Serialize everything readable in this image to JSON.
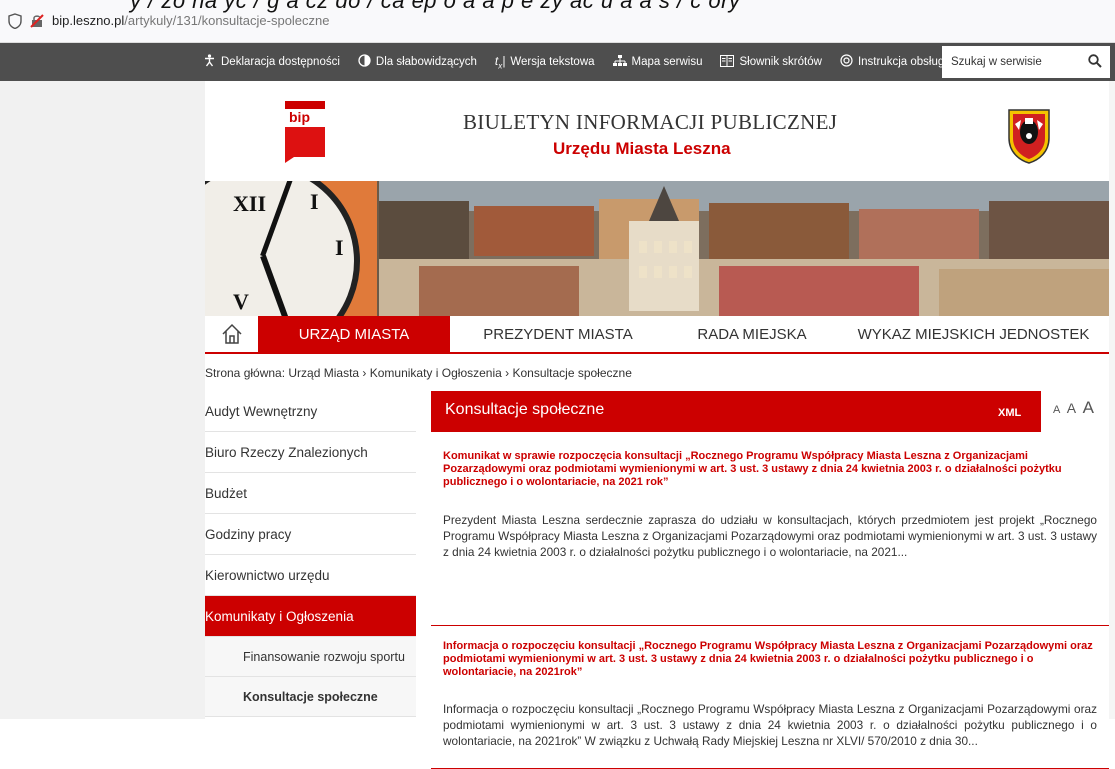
{
  "browser": {
    "url_host": "bip.leszno.pl",
    "url_path": "/artykuly/131/konsultacje-spoleczne",
    "cut_overlay_text": "y / zo na yc / g a cz do / ca ep o a a p e zy ac u a a s / c ory"
  },
  "topbar": {
    "items": [
      {
        "label": "Deklaracja dostępności",
        "icon": "accessibility-icon"
      },
      {
        "label": "Dla słabowidzących",
        "icon": "contrast-icon"
      },
      {
        "label": "Wersja tekstowa",
        "icon": "text-version-icon"
      },
      {
        "label": "Mapa serwisu",
        "icon": "sitemap-icon"
      },
      {
        "label": "Słownik skrótów",
        "icon": "dictionary-icon"
      },
      {
        "label": "Instrukcja obsługi",
        "icon": "help-icon"
      }
    ],
    "search_placeholder": "Szukaj w serwisie"
  },
  "header": {
    "logo_text": "bip",
    "title": "BIULETYN INFORMACJI PUBLICZNEJ",
    "subtitle": "Urzędu Miasta Leszna"
  },
  "nav": {
    "tabs": [
      {
        "label": "URZĄD MIASTA",
        "active": true
      },
      {
        "label": "PREZYDENT MIASTA",
        "active": false
      },
      {
        "label": "RADA MIEJSKA",
        "active": false
      },
      {
        "label": "WYKAZ MIEJSKICH JEDNOSTEK",
        "active": false
      }
    ]
  },
  "breadcrumb": "Strona główna: Urząd Miasta › Komunikaty i Ogłoszenia › Konsultacje społeczne",
  "sidebar": {
    "items": [
      {
        "label": "Audyt Wewnętrzny"
      },
      {
        "label": "Biuro Rzeczy Znalezionych"
      },
      {
        "label": "Budżet"
      },
      {
        "label": "Godziny pracy"
      },
      {
        "label": "Kierownictwo urzędu"
      },
      {
        "label": "Komunikaty i Ogłoszenia"
      }
    ],
    "subitems": [
      {
        "label": "Finansowanie rozwoju sportu"
      },
      {
        "label": "Konsultacje społeczne"
      }
    ]
  },
  "main": {
    "title": "Konsultacje społeczne",
    "xml_label": "XML",
    "font_sizes": [
      "A",
      "A",
      "A"
    ],
    "articles": [
      {
        "title": "Komunikat w sprawie rozpoczęcia konsultacji „Rocznego Programu Współpracy Miasta Leszna z Organizacjami Pozarządowymi oraz podmiotami wymienionymi w art. 3 ust. 3 ustawy z dnia 24 kwietnia 2003 r. o działalności pożytku publicznego i o wolontariacie, na 2021 rok”",
        "text": "Prezydent Miasta Leszna serdecznie zaprasza do udziału w konsultacjach, których przedmiotem jest projekt „Rocznego Programu Współpracy Miasta Leszna z Organizacjami Pozarządowymi oraz podmiotami wymienionymi w art. 3 ust. 3 ustawy z dnia 24 kwietnia 2003 r. o działalności pożytku publicznego i o wolontariacie, na 2021..."
      },
      {
        "title": "Informacja o rozpoczęciu konsultacji „Rocznego Programu Współpracy Miasta Leszna z Organizacjami Pozarządowymi oraz podmiotami wymienionymi w art. 3 ust. 3 ustawy z dnia 24 kwietnia 2003 r. o działalności pożytku publicznego i o wolontariacie, na 2021rok”",
        "text": "Informacja o rozpoczęciu konsultacji „Rocznego Programu Współpracy Miasta Leszna z Organizacjami Pozarządowymi oraz podmiotami wymienionymi w art. 3 ust. 3 ustawy z dnia 24 kwietnia 2003 r. o działalności pożytku publicznego i o wolontariacie, na 2021rok” W związku z Uchwałą Rady Miejskiej Leszna nr XLVI/ 570/2010 z dnia 30..."
      }
    ]
  },
  "colors": {
    "accent": "#cc0000",
    "topbar": "#4e4e4e"
  }
}
